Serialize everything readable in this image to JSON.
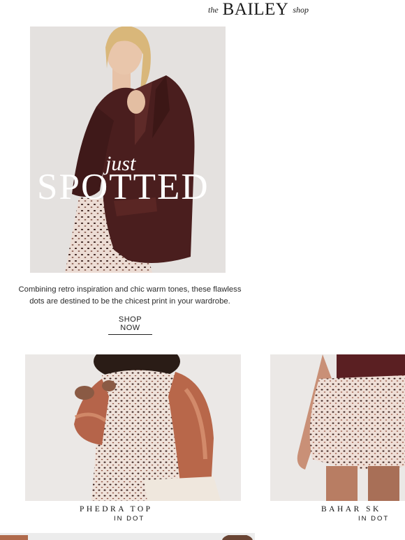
{
  "header": {
    "logo_prefix": "the",
    "logo_main": "BAILEY",
    "logo_suffix": "shop"
  },
  "hero": {
    "overlay_script": "just",
    "overlay_title": "SPOTTED",
    "description": "Combining retro inspiration and chic warm tones, these flawless dots are destined to be the chicest print in your wardrobe.",
    "cta_label": "SHOP NOW"
  },
  "products": [
    {
      "name": "PHEDRA TOP",
      "subtitle": "IN DOT"
    },
    {
      "name": "BAHAR SK",
      "subtitle": "IN DOT"
    }
  ],
  "colors": {
    "leather_jacket": "#4a1e1e",
    "satin_sleeve": "#b8674a",
    "dot_print_bg": "#ecdcd4",
    "dot_print_dots": "#3a1f1c",
    "backdrop": "#e4e1df"
  }
}
